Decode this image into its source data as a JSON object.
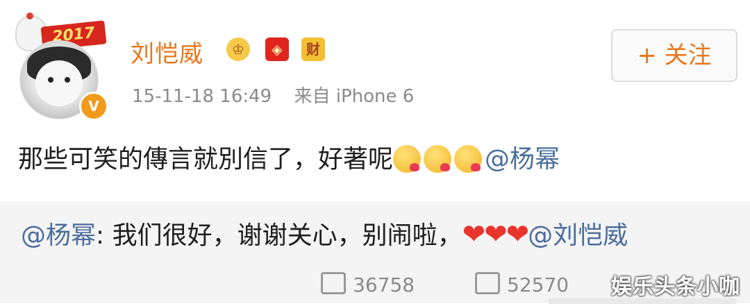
{
  "post": {
    "avatar": {
      "year_tag": "2017",
      "verified_mark": "V"
    },
    "username": "刘恺威",
    "badges": [
      {
        "name": "crown-badge-icon",
        "glyph": "♔"
      },
      {
        "name": "red-envelope-badge-icon",
        "glyph": "◈"
      },
      {
        "name": "cai-badge-icon",
        "glyph": "财"
      }
    ],
    "timestamp": "15-11-18 16:49",
    "source": "来自 iPhone 6",
    "follow_label": "+ 关注",
    "content_text": "那些可笑的傳言就別信了，好著呢",
    "content_mention": "@杨幂"
  },
  "repost": {
    "mention": "@杨幂",
    "text": ": 我们很好，谢谢关心，别闹啦，",
    "hearts": "❤❤❤",
    "mention_end": "@刘恺威"
  },
  "actions": {
    "share_count": "36758",
    "comment_count": "52570"
  },
  "watermark": "娱乐头条小咖",
  "colors": {
    "accent": "#e8761a",
    "mention": "#4a6d9c",
    "heart": "#e8342b"
  }
}
